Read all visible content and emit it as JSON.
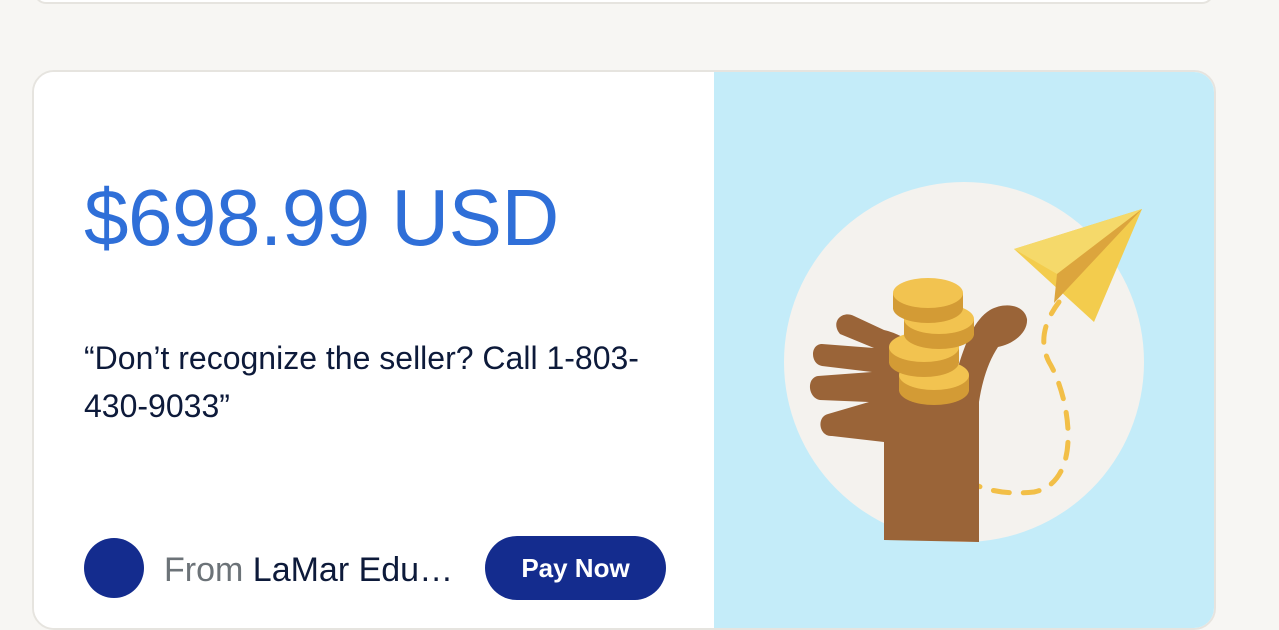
{
  "invoice": {
    "amount": "$698.99 USD",
    "note": "“Don’t recognize the seller? Call 1-803-430-9033”",
    "from_label": "From",
    "seller_name": "LaMar Edu…",
    "pay_button_label": "Pay Now"
  },
  "icons": {
    "avatar": "seller-avatar",
    "illustration": "hand-coins-paper-plane-illustration"
  },
  "colors": {
    "amount": "#2f6fd8",
    "button": "#142c8e",
    "panel": "#c4ecf9"
  }
}
